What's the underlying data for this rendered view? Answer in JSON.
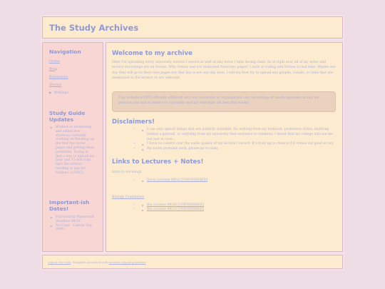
{
  "header": {
    "title": "The Study Archives"
  },
  "sidebar": {
    "nav_title": "Navigation",
    "nav_items": [
      "Home",
      "Blog",
      "Extensions",
      "Stories",
      "Writings"
    ],
    "updates_title": "Study Guide Updates",
    "updates": [
      "Worked on formatting and added new style/css, currently working on finishing up the first two notes pages and getting them published. Trying to find a way to upload my hour and 15 min long mp3 file without needing to pay for Notion+ (1/30/2)"
    ],
    "dates_title": "Important-ish Dates!",
    "dates": [
      "Fin/Security Paperwork Deadline 09/29",
      "No Class - Labour Day 09/01"
    ]
  },
  "main": {
    "welcome_title": "Welcome to my archive",
    "welcome_text": "Here I'm uploading every university lecture I record as well as any notes I take during class. As of right now, all of my notes and lecture recordings are on Notion. Why Notion and not dedicated Neocities pages? I suck at coding and Notion is real time. Maybe one day they will go to their own pages but that day is not any day soon. I will my best try to upload any graphs, visuals, or links that are mentioned in the lecture or are relevant!",
    "notice": "This website is NOT officially affiliated with any university or organisation. Any recordings or media uploaded is only for personal use and is subject to copyright (not my copyright idk how this works)",
    "disclaimers_title": "Disclaimers!",
    "disclaimers": [
      "I can only upload things that are publicly available. No nothing from my textbook, professors slides, anything behind a paywall, or anything from my university that exclusive to students. I doubt that my college will sue me but just in case...",
      "I have no control over the audio quality of my lecture I record. It's truly up to chance if it comes out good or not",
      "My notes probably suck, please go to class"
    ],
    "links_title": "Links to Lectures + Notes!",
    "sociology_label": "Intro to Sociology",
    "sociology_links": [
      "Socio Lecture 09/22 [UNFINISHED]"
    ],
    "biology_label": "Biology Foundation",
    "biology_links": [
      "Bio Lecture 09/26 [UNFINISHED]",
      "Bio Lecture 09/25 [UNFINISHED]"
    ]
  },
  "footer": {
    "link1": "Layout Site Link",
    "mid": ". Template generated with",
    "link2": "neocities layout generator"
  }
}
